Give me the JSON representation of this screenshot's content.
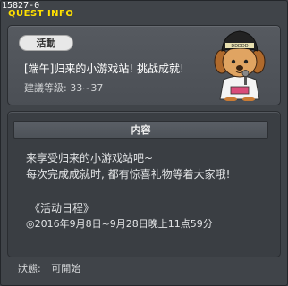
{
  "window": {
    "quest_id": "15827-0",
    "title": "QUEST INFO"
  },
  "quest": {
    "category_tab": "活動",
    "name": "[端午]归来的小游戏站! 挑战成就!",
    "level_requirement": "建議等級: 33~37",
    "npc_icon": "dog-npc-icon"
  },
  "content": {
    "header": "内容",
    "description_lines": [
      "来享受归来的小游戏站吧~",
      "每次完成成就时, 都有惊喜礼物等着大家哦!"
    ],
    "schedule_title": "《活动日程》",
    "schedule_date": "◎2016年9月8日~9月28日晚上11点59分"
  },
  "status": {
    "label": "狀態:",
    "value": "可開始"
  },
  "colors": {
    "title": "#ffe000",
    "background": "#404449",
    "panel": "#565a60",
    "tab": "#e8e8e8"
  }
}
